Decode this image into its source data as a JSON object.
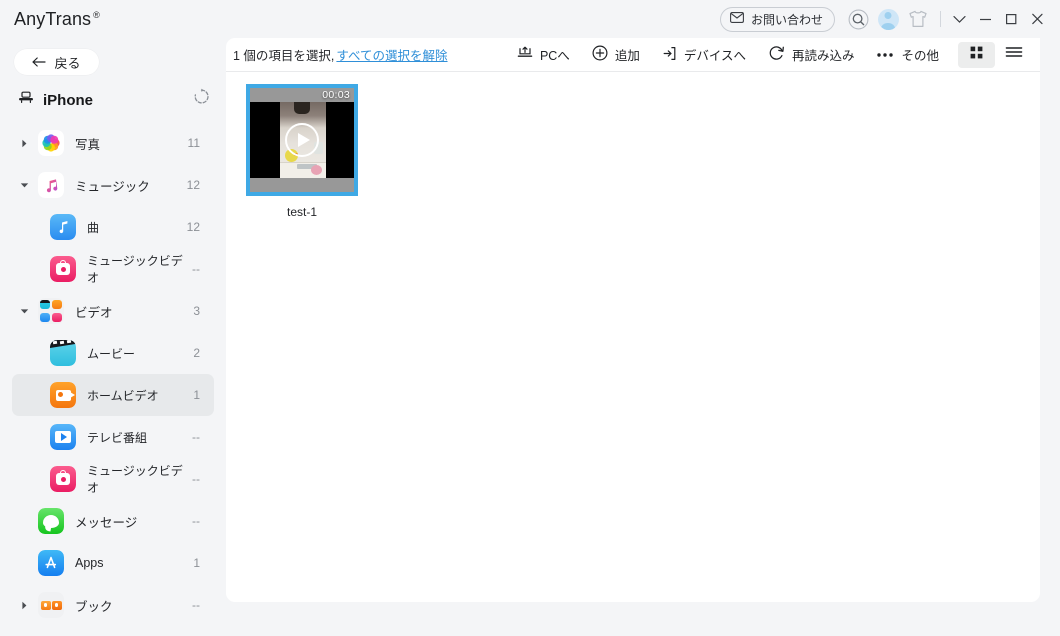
{
  "titlebar": {
    "brand": "AnyTrans",
    "brand_mark": "®",
    "contact_label": "お問い合わせ",
    "icons": {
      "mail": "mail-icon",
      "search": "search-icon",
      "avatar": "avatar",
      "theme": "tshirt-icon",
      "chevron": "chevron-down-icon",
      "minimize": "minimize-icon",
      "maximize": "maximize-icon",
      "close": "close-icon"
    }
  },
  "sidebar": {
    "back_label": "戻る",
    "refresh_label": "refresh-icon",
    "device_name": "iPhone",
    "items": [
      {
        "label": "写真",
        "count": "11",
        "level": 0,
        "arrow": "right",
        "icon": "photos-icon",
        "selected": false
      },
      {
        "label": "ミュージック",
        "count": "12",
        "level": 0,
        "arrow": "down",
        "icon": "music-icon",
        "selected": false
      },
      {
        "label": "曲",
        "count": "12",
        "level": 1,
        "arrow": "",
        "icon": "songs-icon",
        "selected": false
      },
      {
        "label": "ミュージックビデオ",
        "count": "--",
        "level": 1,
        "arrow": "",
        "icon": "musicvideo-icon",
        "selected": false
      },
      {
        "label": "ビデオ",
        "count": "3",
        "level": 0,
        "arrow": "down",
        "icon": "videos-icon",
        "selected": false
      },
      {
        "label": "ムービー",
        "count": "2",
        "level": 1,
        "arrow": "",
        "icon": "movies-icon",
        "selected": false
      },
      {
        "label": "ホームビデオ",
        "count": "1",
        "level": 1,
        "arrow": "",
        "icon": "homevideo-icon",
        "selected": true
      },
      {
        "label": "テレビ番組",
        "count": "--",
        "level": 1,
        "arrow": "",
        "icon": "tvshows-icon",
        "selected": false
      },
      {
        "label": "ミュージックビデオ",
        "count": "--",
        "level": 1,
        "arrow": "",
        "icon": "musicvideo-icon",
        "selected": false
      },
      {
        "label": "メッセージ",
        "count": "--",
        "level": 0,
        "arrow": "",
        "icon": "messages-icon",
        "selected": false
      },
      {
        "label": "Apps",
        "count": "1",
        "level": 0,
        "arrow": "",
        "icon": "appstore-icon",
        "selected": false
      },
      {
        "label": "ブック",
        "count": "--",
        "level": 0,
        "arrow": "right",
        "icon": "books-icon",
        "selected": false
      }
    ]
  },
  "toolbar": {
    "selection_text": "1 個の項目を選択,",
    "deselect_link": "すべての選択を解除",
    "actions": [
      {
        "label": "PCへ",
        "icon": "export-to-pc-icon"
      },
      {
        "label": "追加",
        "icon": "plus-circle-icon"
      },
      {
        "label": "デバイスへ",
        "icon": "to-device-icon"
      },
      {
        "label": "再読み込み",
        "icon": "reload-icon"
      },
      {
        "label": "その他",
        "icon": "more-dots-icon"
      }
    ],
    "view_grid": "grid-view-icon",
    "view_list": "list-view-icon",
    "view_active": "grid"
  },
  "content": {
    "items": [
      {
        "name": "test-1",
        "duration": "00:03",
        "selected": true,
        "play": "play-icon"
      }
    ]
  },
  "colors": {
    "accent_blue": "#3fa9e5",
    "link_blue": "#2f8fd8",
    "sidebar_bg": "#f4f5f7",
    "panel_bg": "#ffffff",
    "selected_row": "#e7e9eb"
  }
}
